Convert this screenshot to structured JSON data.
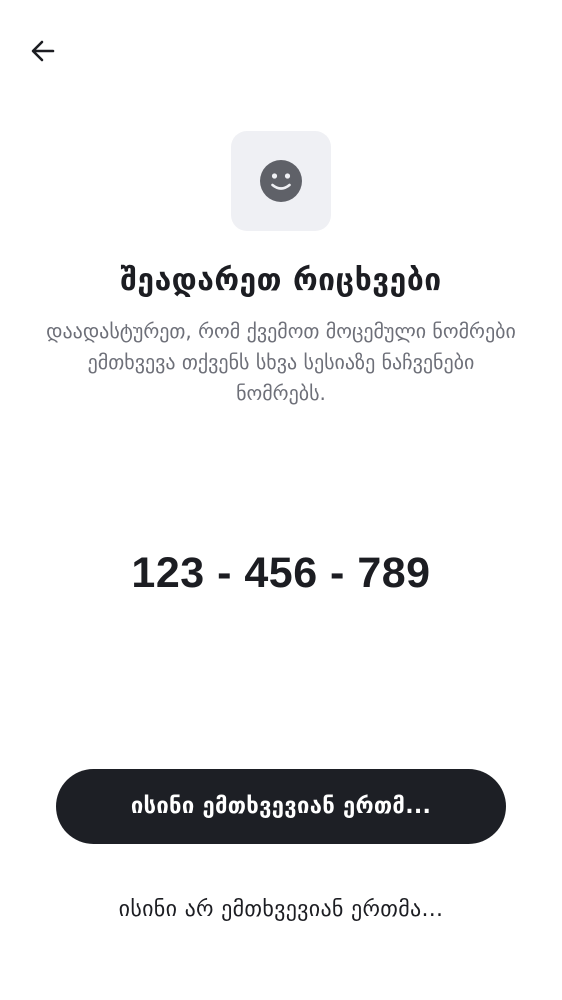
{
  "header": {
    "back_icon": "arrow-left-icon"
  },
  "hero": {
    "icon": "smiley-face-icon",
    "icon_color": "#5f6168",
    "tile_color": "#eff0f4"
  },
  "content": {
    "title": "შეადარეთ რიცხვები",
    "description": "დაადასტურეთ, რომ ქვემოთ მოცემული ნომრები ემთხვევა თქვენს სხვა სესიაზე ნაჩვენები ნომრებს.",
    "numbers": "123 - 456 - 789"
  },
  "actions": {
    "confirm_label": "ისინი ემთხვევიან ერთმ...",
    "reject_label": "ისინი არ ემთხვევიან ერთმა..."
  },
  "colors": {
    "primary_button": "#1d1f25",
    "text_primary": "#1c1d22",
    "text_secondary": "#6d6f78"
  }
}
